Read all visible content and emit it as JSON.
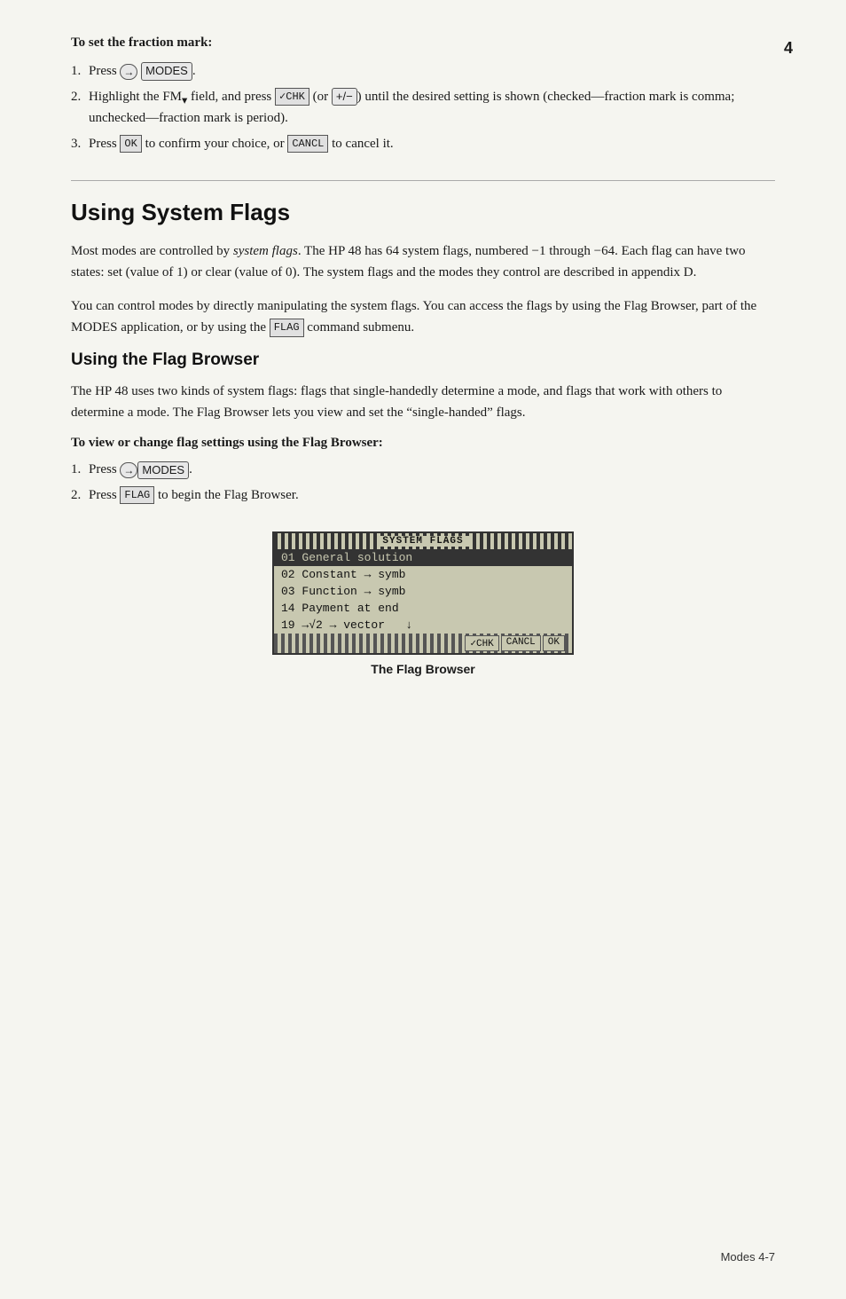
{
  "page": {
    "number": "4",
    "footer": "Modes  4-7"
  },
  "top_section": {
    "label": "To set the fraction mark:",
    "steps": [
      {
        "num": "1.",
        "text_before": "Press",
        "key1": "→",
        "key2": "MODES",
        "text_after": ""
      },
      {
        "num": "2.",
        "text": "Highlight the FM▾ field, and press ✓CHK (or +/-) until the desired setting is shown (checked—fraction mark is comma; unchecked—fraction mark is period)."
      },
      {
        "num": "3.",
        "text": "Press  OK  to confirm your choice, or CANCL to cancel it."
      }
    ]
  },
  "main_section": {
    "title": "Using System Flags",
    "para1": "Most modes are controlled by system flags. The HP 48 has 64 system flags, numbered −1 through −64. Each flag can have two states: set (value of 1) or clear (value of 0). The system flags and the modes they control are described in appendix D.",
    "para2": "You can control modes by directly manipulating the system flags. You can access the flags by using the Flag Browser, part of the MODES application, or by using the FLAG command submenu.",
    "sub_section": {
      "title": "Using the Flag Browser",
      "para1": "The HP 48 uses two kinds of system flags: flags that single-handedly determine a mode, and flags that work with others to determine a mode. The Flag Browser lets you view and set the \"single-handed\" flags.",
      "to_label": "To view or change flag settings using the Flag Browser:",
      "steps": [
        {
          "num": "1.",
          "text_before": "Press",
          "key1": "→",
          "key2": "MODES",
          "text_after": "."
        },
        {
          "num": "2.",
          "text_before": "Press",
          "key_inline": "FLAG",
          "text_after": "to begin the Flag Browser."
        }
      ],
      "display": {
        "title": "SYSTEM FLAGS",
        "rows": [
          {
            "text": "01 General solution",
            "selected": true
          },
          {
            "text": "02 Constant → symb",
            "selected": false
          },
          {
            "text": "03 Function → symb",
            "selected": false
          },
          {
            "text": "14 Payment at end",
            "selected": false
          },
          {
            "text": "19 →√2 → vector",
            "selected": false,
            "arrow": "↓"
          }
        ],
        "softkeys": [
          "✓CHK",
          "CANCL",
          "OK"
        ],
        "caption": "The Flag Browser"
      }
    }
  }
}
